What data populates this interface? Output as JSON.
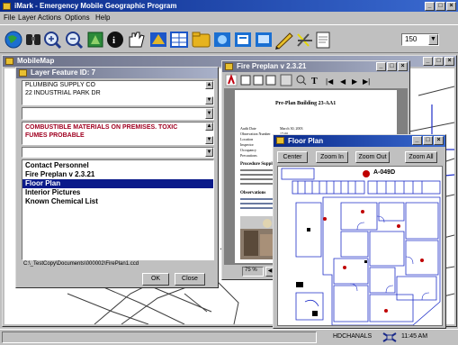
{
  "app": {
    "title": "iMark - Emergency Mobile Geographic Program",
    "menu": [
      "File",
      "Layer Actions",
      "Options",
      "Help"
    ],
    "scale_value": "150"
  },
  "toolbar": {
    "icons": [
      "binoculars-icon",
      "zoom-in-icon",
      "zoom-out-icon",
      "pan-icon",
      "info-icon",
      "hand-icon",
      "layers-icon",
      "table-icon",
      "folder-icon",
      "map-icon",
      "map-icon-2",
      "display-icon",
      "pencil-icon",
      "erase-icon",
      "document-icon"
    ]
  },
  "mapwin": {
    "title": "MobileMap"
  },
  "layer_window": {
    "title": "Layer Feature ID: 7",
    "field1_line1": "PLUMBING SUPPLY CO",
    "field1_line2": "22 INDUSTRIAL PARK DR",
    "field2_line1": "COMBUSTIBLE MATERIALS ON PREMISES. TOXIC",
    "field2_line2": "FUMES PROBABLE",
    "list": [
      "Contact Personnel",
      "Fire Preplan v 2.3.21",
      "Floor Plan",
      "Interior Pictures",
      "Known Chemical List"
    ],
    "selected_index": 2,
    "path": "C:\\_TestCopy\\Documents\\000002\\FirePlan1.ccd",
    "ok_label": "OK",
    "close_label": "Close"
  },
  "preplan_window": {
    "title": "Fire Preplan v 2.3.21",
    "doc_title": "Pre-Plan Building 23-AA1",
    "zoom": "75 %",
    "fields": [
      "Audit Date",
      "Observation Number",
      "Location",
      "Inspector",
      "Occupancy",
      "Precautions"
    ],
    "values": [
      "March 30, 2003",
      "17:00",
      "",
      "",
      "",
      ""
    ],
    "section1": "Procedure Supplement",
    "section2": "Observations"
  },
  "floorplan_window": {
    "title": "Floor Plan",
    "buttons": [
      "Center",
      "Zoom In",
      "Zoom Out",
      "Zoom All"
    ],
    "plan_id": "A-049D"
  },
  "status": {
    "user": "HDCHANALS",
    "time": "11:45 AM"
  },
  "colors": {
    "title_active": "#0a2a8a",
    "title_inactive": "#6a6f86",
    "highlight": "#0a1a8a",
    "warning_text": "#a00020"
  }
}
